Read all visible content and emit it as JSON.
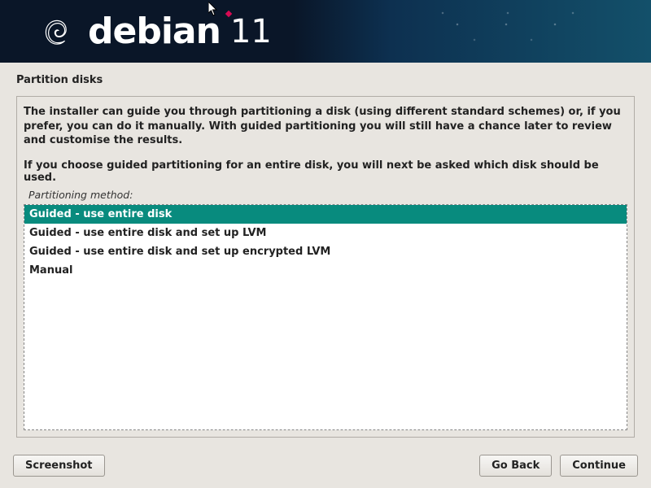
{
  "header": {
    "brand": "debian",
    "version": "11"
  },
  "page": {
    "title": "Partition disks",
    "intro": "The installer can guide you through partitioning a disk (using different standard schemes) or, if you prefer, you can do it manually. With guided partitioning you will still have a chance later to review and customise the results.",
    "note": "If you choose guided partitioning for an entire disk, you will next be asked which disk should be used.",
    "method_label": "Partitioning method:"
  },
  "options": [
    {
      "label": "Guided - use entire disk",
      "selected": true
    },
    {
      "label": "Guided - use entire disk and set up LVM",
      "selected": false
    },
    {
      "label": "Guided - use entire disk and set up encrypted LVM",
      "selected": false
    },
    {
      "label": "Manual",
      "selected": false
    }
  ],
  "buttons": {
    "screenshot": "Screenshot",
    "go_back": "Go Back",
    "continue": "Continue"
  }
}
